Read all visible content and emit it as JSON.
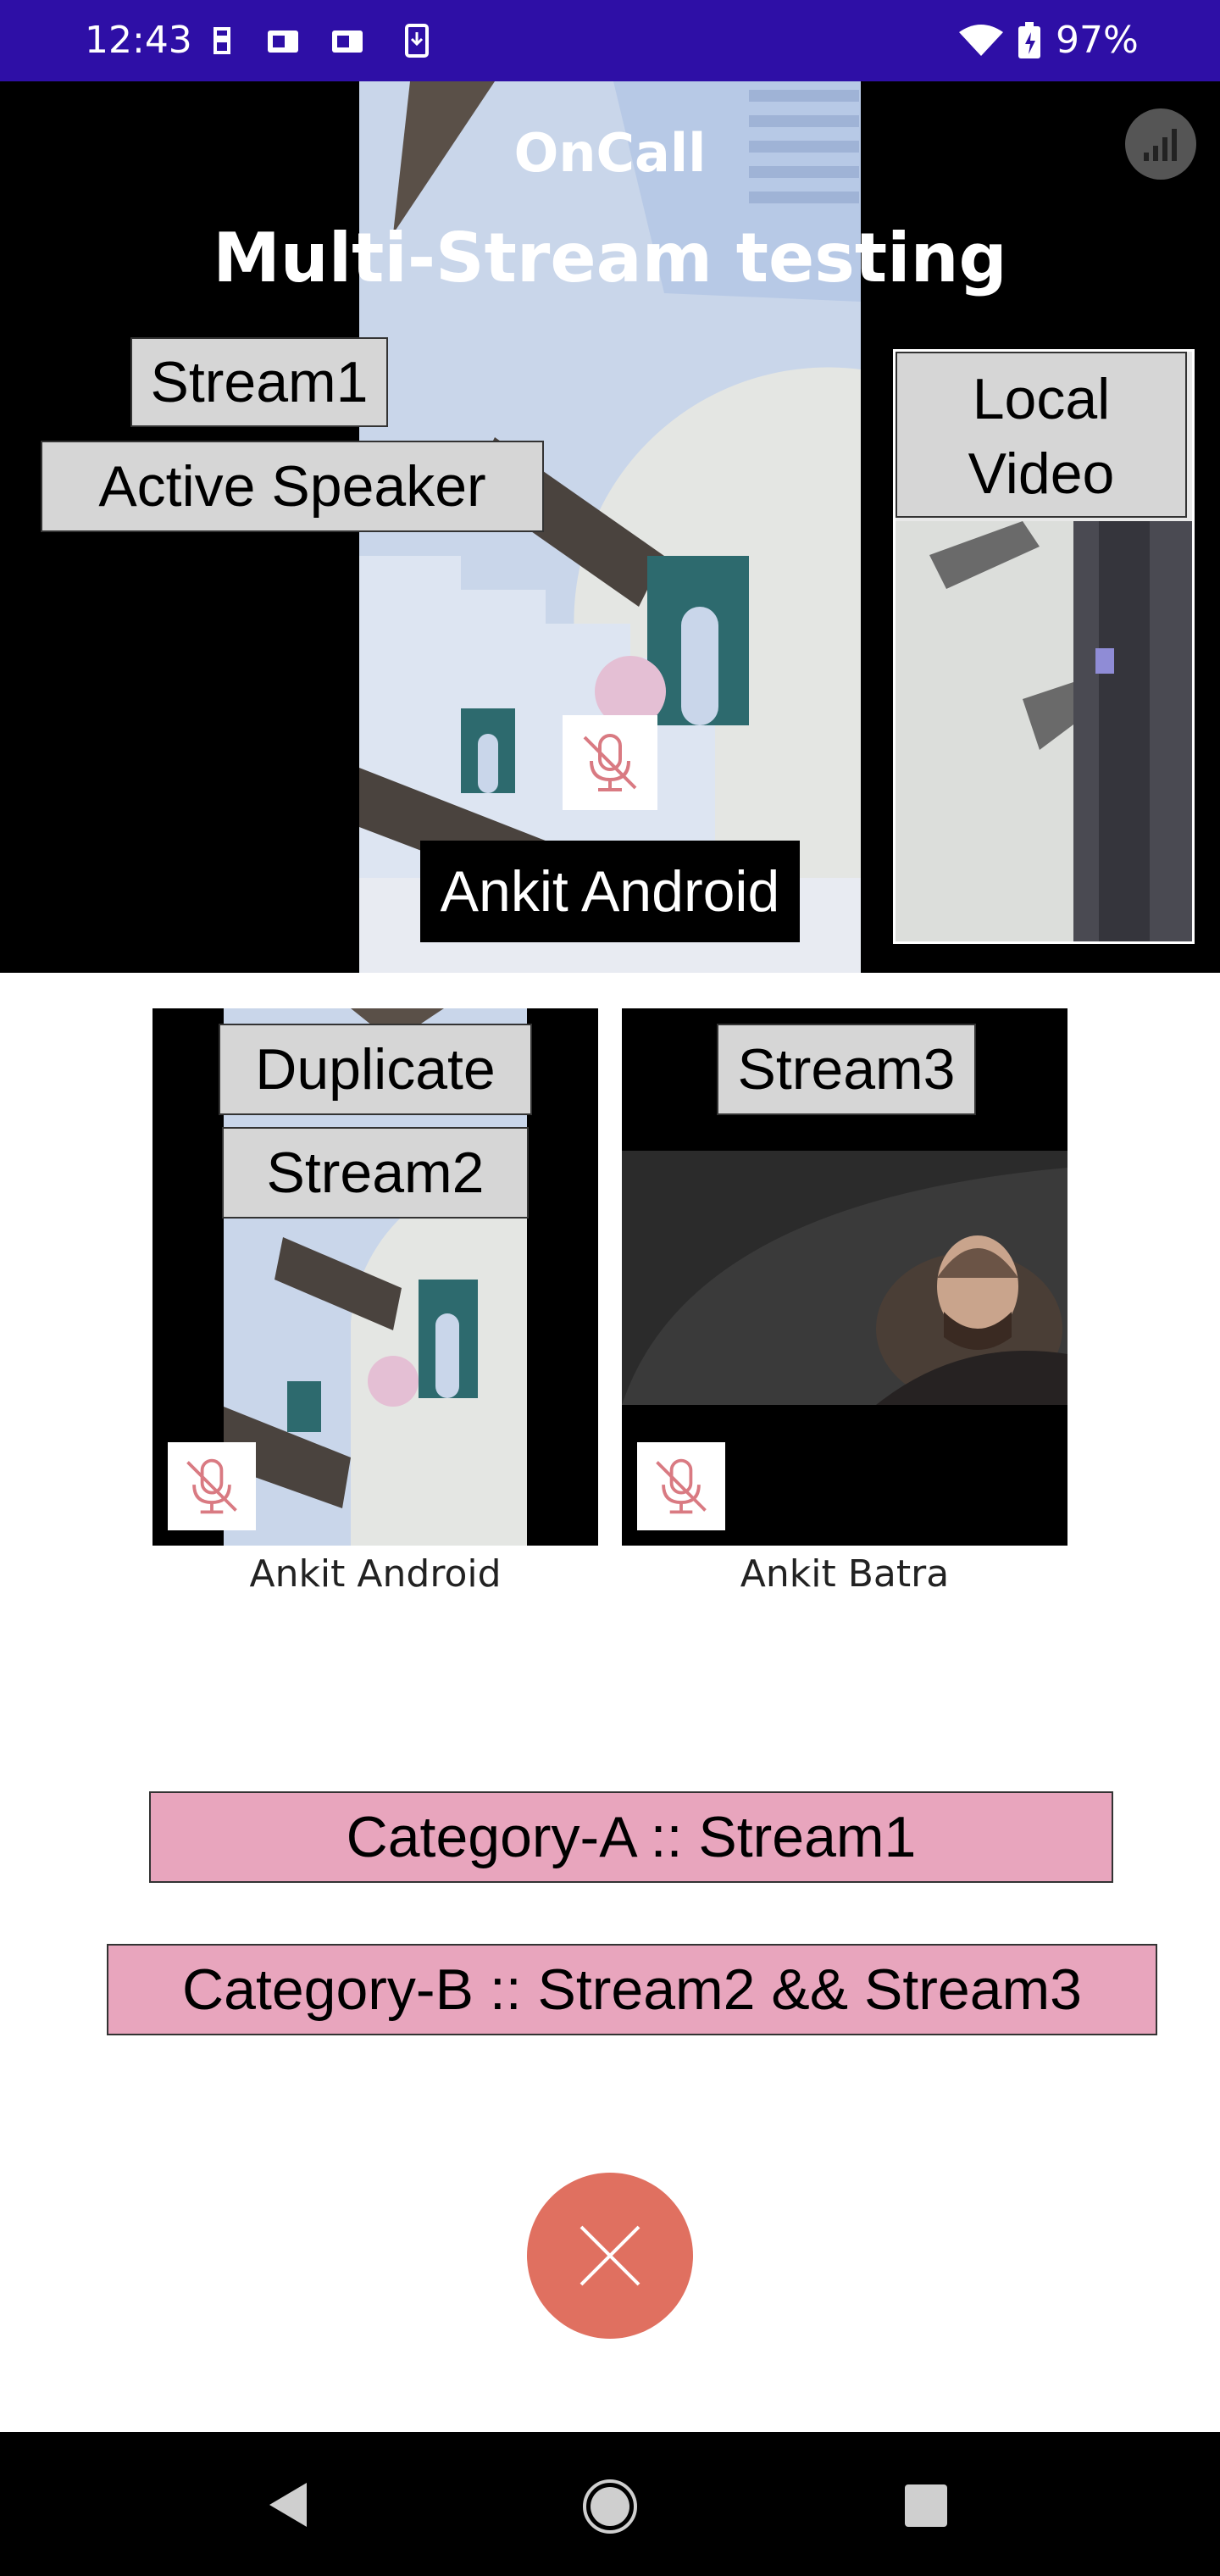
{
  "status_bar": {
    "time": "12:43",
    "battery": "97%",
    "icons": [
      "notification-icon",
      "teams-icon",
      "teams-icon",
      "download-icon",
      "wifi-icon",
      "battery-icon"
    ]
  },
  "header": {
    "app_name": "OnCall",
    "title": "Multi-Stream testing",
    "signal_icon": "signal-bars-icon"
  },
  "main_stream": {
    "stream_label": "Stream1",
    "active_speaker_label": "Active Speaker",
    "participant_name": "Ankit Android",
    "mute_icon": "mic-off-icon"
  },
  "local_video": {
    "label": "Local Video"
  },
  "grid": {
    "tiles": [
      {
        "label_line1": "Duplicate",
        "label_line2": "Stream2",
        "name": "Ankit Android",
        "mute_icon": "mic-off-icon"
      },
      {
        "label_line1": "Stream3",
        "name": "Ankit Batra",
        "mute_icon": "mic-off-icon"
      }
    ]
  },
  "categories": {
    "a": "Category-A :: Stream1",
    "b": "Category-B :: Stream2 && Stream3"
  },
  "controls": {
    "end_call_icon": "close-icon"
  },
  "nav": {
    "back_icon": "back-icon",
    "home_icon": "home-icon",
    "recents_icon": "recents-icon"
  },
  "colors": {
    "status_bar": "#2e0fa6",
    "end_call": "#e07060",
    "category_bg": "#e8a5bd"
  }
}
